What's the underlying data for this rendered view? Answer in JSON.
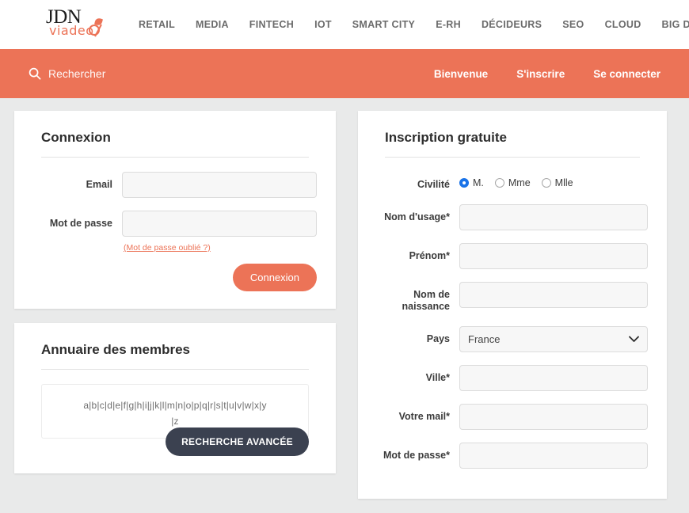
{
  "colors": {
    "accent_orange": "#ec7357",
    "dark_button": "#3b4150",
    "page_background": "#e9eaea",
    "card_background": "#ffffff",
    "input_background": "#f7f7f7",
    "radio_selected": "#1a73e8"
  },
  "header": {
    "logo": {
      "primary": "JDN",
      "secondary": "viadeo",
      "leaf_icon": "leaf-accent-icon"
    },
    "nav_items": [
      {
        "label": "RETAIL"
      },
      {
        "label": "MEDIA"
      },
      {
        "label": "FINTECH"
      },
      {
        "label": "IOT"
      },
      {
        "label": "SMART CITY"
      },
      {
        "label": "E-RH"
      },
      {
        "label": "DÉCIDEURS"
      },
      {
        "label": "SEO"
      },
      {
        "label": "CLOUD"
      },
      {
        "label": "BIG DATA"
      }
    ]
  },
  "orange_bar": {
    "search": {
      "icon": "search-icon",
      "placeholder": "Rechercher",
      "value": ""
    },
    "links": [
      {
        "label": "Bienvenue"
      },
      {
        "label": "S'inscrire"
      },
      {
        "label": "Se connecter"
      }
    ]
  },
  "login_card": {
    "title": "Connexion",
    "fields": [
      {
        "label": "Email",
        "value": "",
        "type": "text"
      },
      {
        "label": "Mot de passe",
        "value": "",
        "type": "password"
      }
    ],
    "forgot_password_link": "(Mot de passe oublié ?)",
    "submit_label": "Connexion"
  },
  "directory_card": {
    "title": "Annuaire des membres",
    "alphabet_line1": "a|b|c|d|e|f|g|h|i|j|k|l|m|n|o|p|q|r|s|t|u|v|w|x|y",
    "alphabet_line2": "|z",
    "advanced_search_label": "RECHERCHE AVANCÉE"
  },
  "signup_card": {
    "title": "Inscription gratuite",
    "civility": {
      "label": "Civilité",
      "options": [
        {
          "label": "M.",
          "selected": true
        },
        {
          "label": "Mme",
          "selected": false
        },
        {
          "label": "Mlle",
          "selected": false
        }
      ]
    },
    "fields": [
      {
        "label": "Nom d'usage*",
        "value": "",
        "type": "text"
      },
      {
        "label": "Prénom*",
        "value": "",
        "type": "text"
      },
      {
        "label": "Nom de naissance",
        "label_line1": "Nom de",
        "label_line2": "naissance",
        "value": "",
        "type": "text"
      },
      {
        "label": "Pays",
        "value": "France",
        "type": "select",
        "icon": "chevron-down-icon"
      },
      {
        "label": "Ville*",
        "value": "",
        "type": "text"
      },
      {
        "label": "Votre mail*",
        "value": "",
        "type": "text"
      },
      {
        "label": "Mot de passe*",
        "value": "",
        "type": "password"
      }
    ]
  }
}
